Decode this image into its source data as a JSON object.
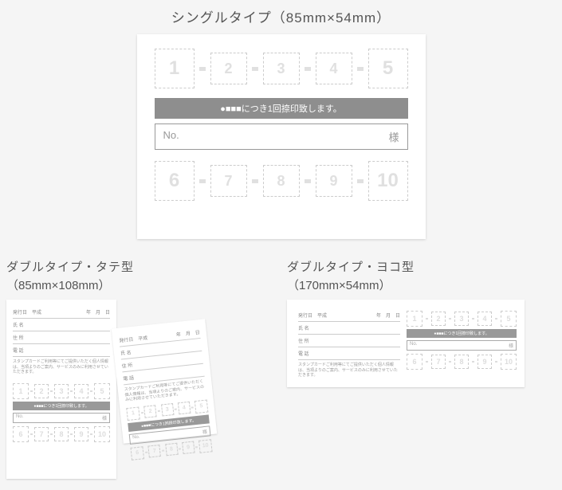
{
  "single": {
    "title": "シングルタイプ（85mm×54mm）",
    "stamps_top": [
      "1",
      "2",
      "3",
      "4",
      "5"
    ],
    "bar_text": "●■■■につき1回捺印致します。",
    "no_label": "No.",
    "sama": "様",
    "stamps_bottom": [
      "6",
      "7",
      "8",
      "9",
      "10"
    ]
  },
  "double_vert": {
    "title1": "ダブルタイプ・タテ型",
    "title2": "（85mm×108mm）",
    "form": {
      "date_label": "発行日　平成",
      "y": "年",
      "m": "月",
      "d": "日",
      "name": "氏 名",
      "addr": "住 所",
      "tel": "電 話"
    },
    "note": "スタンプカードご利用等にてご提供いただく個人情報は、当項よりのご案内、サービスのみに利用させていただきます。",
    "stamps_top": [
      "1",
      "2",
      "3",
      "4",
      "5"
    ],
    "bar_text": "●■■■につき1回捺印致します。",
    "no_label": "No.",
    "sama": "様",
    "stamps_bottom": [
      "6",
      "7",
      "8",
      "9",
      "10"
    ]
  },
  "double_horiz": {
    "title1": "ダブルタイプ・ヨコ型",
    "title2": "（170mm×54mm）",
    "form": {
      "date_label": "発行日　平成",
      "y": "年",
      "m": "月",
      "d": "日",
      "name": "氏 名",
      "addr": "住 所",
      "tel": "電 話"
    },
    "note": "スタンプカードご利用等にてご提供いただく個人情報は、当項よりのご案内、サービスのみに利用させていただきます。",
    "stamps_top": [
      "1",
      "2",
      "3",
      "4",
      "5"
    ],
    "bar_text": "●■■■につき1回捺印致します。",
    "no_label": "No.",
    "sama": "様",
    "stamps_bottom": [
      "6",
      "7",
      "8",
      "9",
      "10"
    ]
  }
}
